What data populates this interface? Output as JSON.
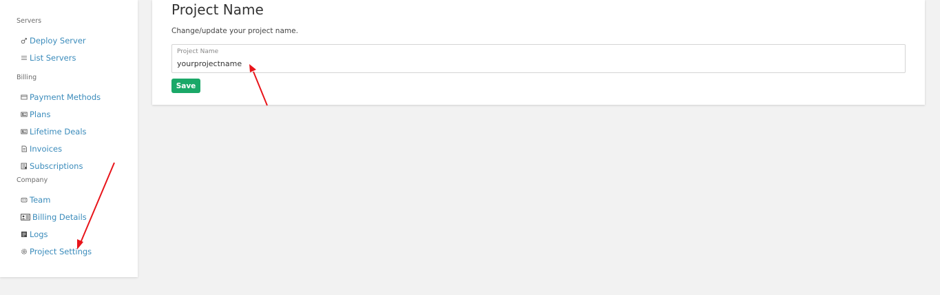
{
  "sidebar": {
    "sections": [
      {
        "label": "Servers"
      },
      {
        "label": "Billing"
      },
      {
        "label": "Company"
      }
    ],
    "items": [
      {
        "label": "Deploy Server",
        "icon": "plug-icon"
      },
      {
        "label": "List Servers",
        "icon": "list-icon"
      },
      {
        "label": "Payment Methods",
        "icon": "credit-card-icon"
      },
      {
        "label": "Plans",
        "icon": "plans-icon"
      },
      {
        "label": "Lifetime Deals",
        "icon": "deal-icon"
      },
      {
        "label": "Invoices",
        "icon": "invoice-icon"
      },
      {
        "label": "Subscriptions",
        "icon": "subscriptions-icon"
      },
      {
        "label": "Team",
        "icon": "team-icon"
      },
      {
        "label": "Billing Details",
        "icon": "id-card-icon"
      },
      {
        "label": "Logs",
        "icon": "logs-icon"
      },
      {
        "label": "Project Settings",
        "icon": "gear-icon"
      }
    ]
  },
  "main": {
    "title": "Project Name",
    "subtitle": "Change/update your project name.",
    "field": {
      "label": "Project Name",
      "value": "yourprojectname"
    },
    "save_label": "Save"
  },
  "colors": {
    "link": "#3a8bbb",
    "save_button": "#1aa868",
    "annotation_arrow": "#e8141a",
    "background": "#f2f2f2"
  }
}
